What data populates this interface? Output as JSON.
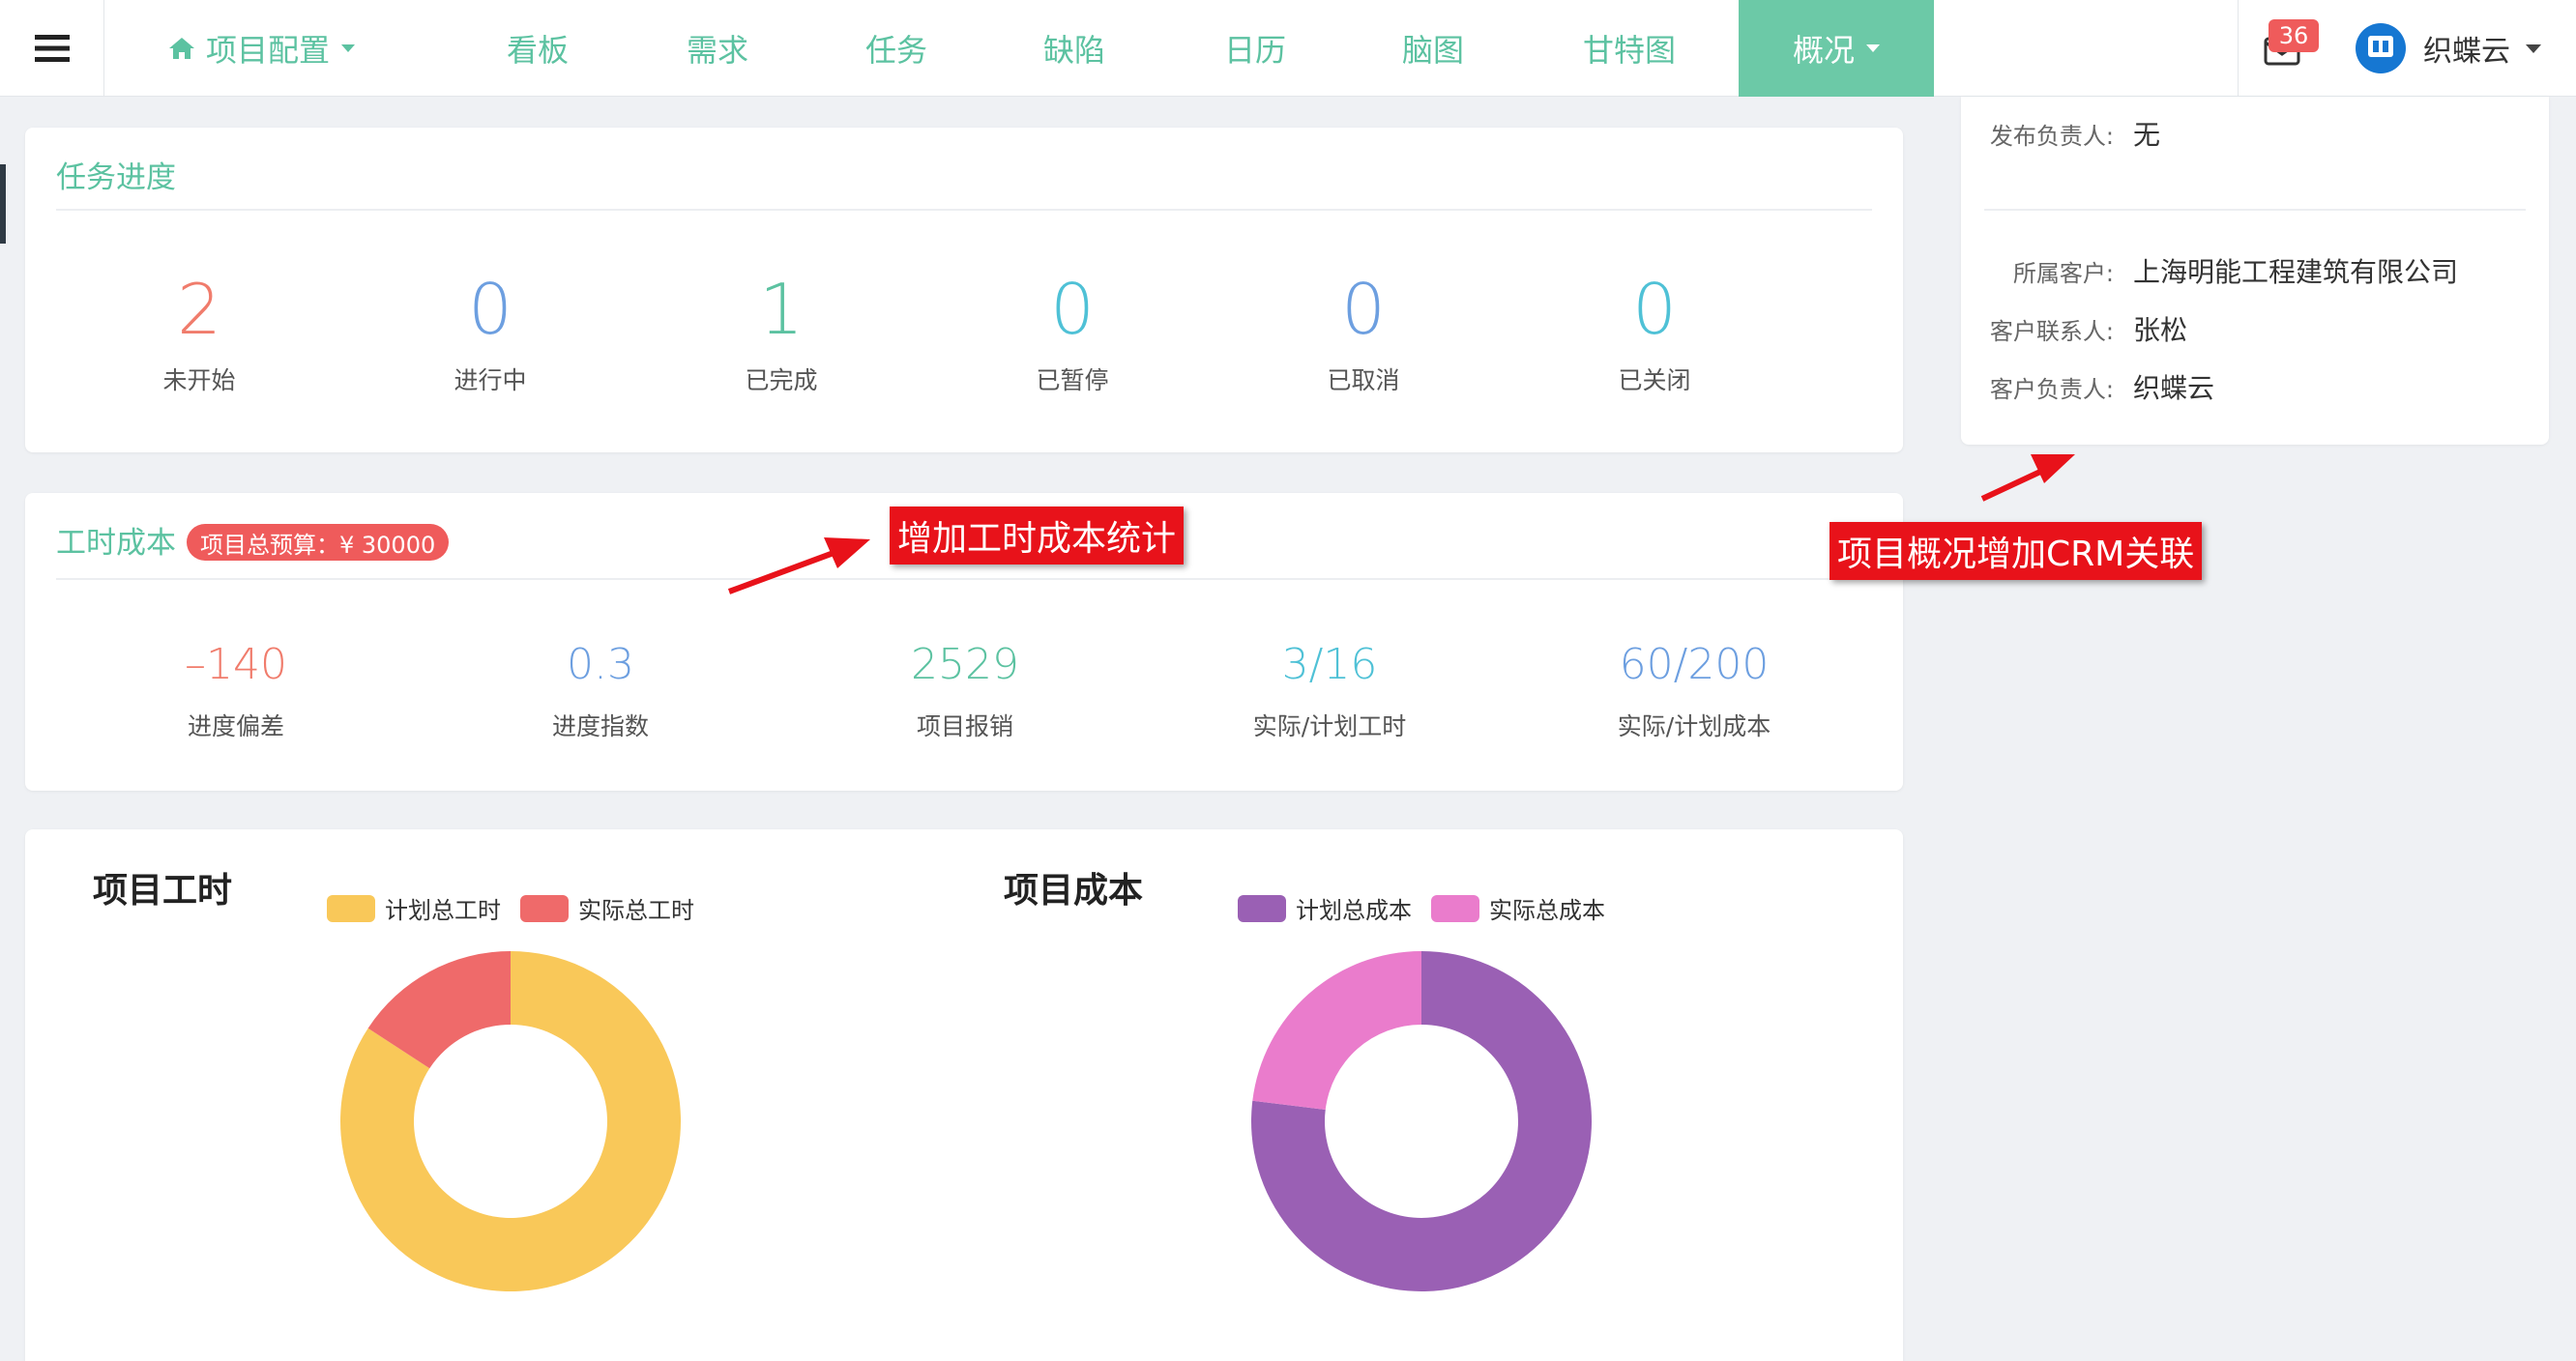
{
  "nav": {
    "project_config": "项目配置",
    "items": [
      "看板",
      "需求",
      "任务",
      "缺陷",
      "日历",
      "脑图",
      "甘特图"
    ],
    "overview": "概况",
    "mail_count": "36",
    "username": "织蝶云",
    "accent_color": "#6cc9a7"
  },
  "task_progress": {
    "title": "任务进度",
    "stats": [
      {
        "value": "2",
        "label": "未开始",
        "color": "#f07c6c"
      },
      {
        "value": "0",
        "label": "进行中",
        "color": "#6d9fe0"
      },
      {
        "value": "1",
        "label": "已完成",
        "color": "#5cc2a1"
      },
      {
        "value": "0",
        "label": "已暂停",
        "color": "#4fc1d6"
      },
      {
        "value": "0",
        "label": "已取消",
        "color": "#6d9fe0"
      },
      {
        "value": "0",
        "label": "已关闭",
        "color": "#4fc1d6"
      }
    ]
  },
  "cost": {
    "title": "工时成本",
    "budget_badge": "项目总预算：¥ 30000",
    "stats": [
      {
        "value": "–140",
        "label": "进度偏差",
        "color": "#f07c6c"
      },
      {
        "value": "0.3",
        "label": "进度指数",
        "color": "#6d9fe0"
      },
      {
        "value": "2529",
        "label": "项目报销",
        "color": "#5cc2a1"
      },
      {
        "value": "3/16",
        "label": "实际/计划工时",
        "color": "#4fc1d6"
      },
      {
        "value": "60/200",
        "label": "实际/计划成本",
        "color": "#6d9fe0"
      }
    ]
  },
  "annotations": {
    "cost_note": "增加工时成本统计",
    "crm_note": "项目概况增加CRM关联"
  },
  "project_info": {
    "release_owner_label": "发布负责人:",
    "release_owner_value": "无",
    "customer_label": "所属客户:",
    "customer_value": "上海明能工程建筑有限公司",
    "contact_label": "客户联系人:",
    "contact_value": "张松",
    "customer_owner_label": "客户负责人:",
    "customer_owner_value": "织蝶云"
  },
  "chart_data": [
    {
      "type": "pie",
      "title": "项目工时",
      "categories": [
        "计划总工时",
        "实际总工时"
      ],
      "values": [
        16,
        3
      ],
      "colors": [
        "#f9c859",
        "#ef6a6a"
      ],
      "donut": true
    },
    {
      "type": "pie",
      "title": "项目成本",
      "categories": [
        "计划总成本",
        "实际总成本"
      ],
      "values": [
        200,
        60
      ],
      "colors": [
        "#9a60b4",
        "#ea7ccc"
      ],
      "donut": true
    }
  ]
}
